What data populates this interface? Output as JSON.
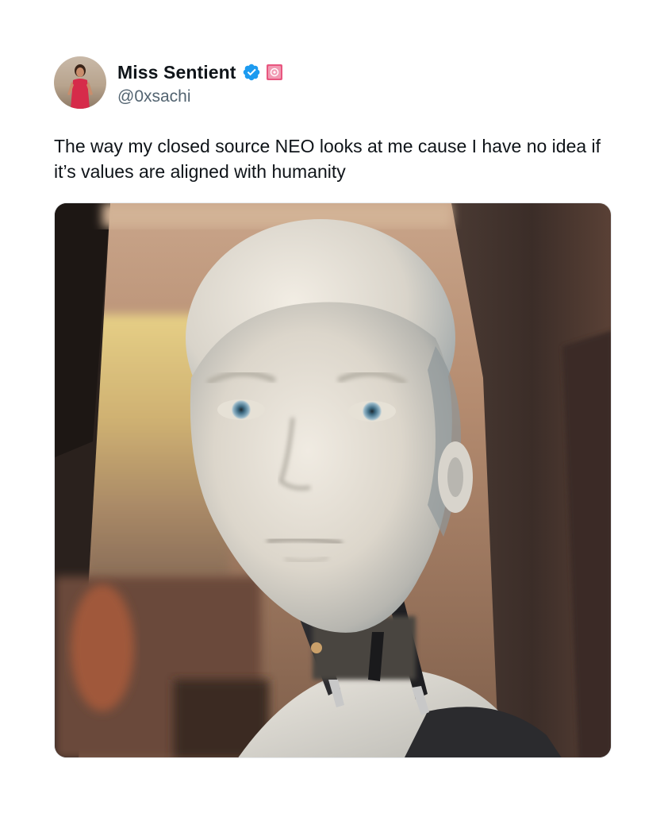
{
  "author": {
    "display_name": "Miss Sentient",
    "handle": "@0xsachi",
    "verified_icon": "verified-badge-icon",
    "affiliate_icon": "affiliate-badge-icon",
    "avatar_icon": "profile-avatar"
  },
  "post": {
    "text": "The way my closed source NEO looks at me cause I have no idea if it’s values are aligned with humanity",
    "media": {
      "kind": "photo",
      "subject": "humanoid robot head"
    }
  },
  "colors": {
    "verified": "#1d9bf0",
    "affiliate_badge": "#e8567f",
    "text": "#0f1419",
    "secondary_text": "#536471"
  }
}
